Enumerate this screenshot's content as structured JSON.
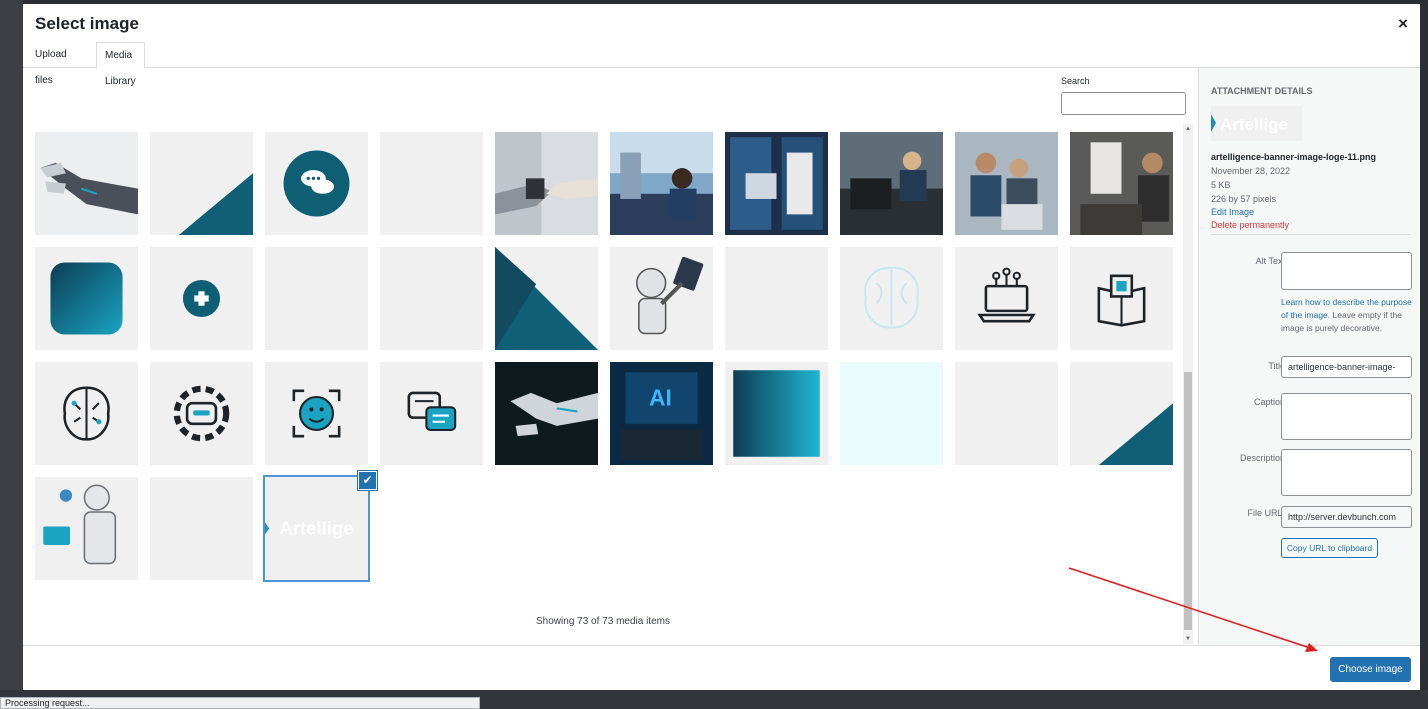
{
  "modal": {
    "title": "Select image",
    "close_label": "×",
    "tabs": [
      {
        "label": "Upload files",
        "active": false
      },
      {
        "label": "Media Library",
        "active": true
      }
    ]
  },
  "search": {
    "label": "Search",
    "value": ""
  },
  "media_grid": {
    "items": [
      {
        "kind": "robot-hand"
      },
      {
        "kind": "triangle"
      },
      {
        "kind": "chat-bubble-icon"
      },
      {
        "kind": "blank"
      },
      {
        "kind": "robot-handshake-photo"
      },
      {
        "kind": "lab-photo"
      },
      {
        "kind": "server-rack-photo"
      },
      {
        "kind": "engineer-photo"
      },
      {
        "kind": "team-laptop-photo"
      },
      {
        "kind": "robot-hand-photo"
      },
      {
        "kind": "rounded-square"
      },
      {
        "kind": "plus-circle"
      },
      {
        "kind": "blank"
      },
      {
        "kind": "blank"
      },
      {
        "kind": "triangle-left"
      },
      {
        "kind": "humanoid-robot"
      },
      {
        "kind": "blank"
      },
      {
        "kind": "brain-outline"
      },
      {
        "kind": "laptop-circuit-icon"
      },
      {
        "kind": "book-chip-icon"
      },
      {
        "kind": "brain-circuit-icon"
      },
      {
        "kind": "gear-robot-icon"
      },
      {
        "kind": "face-scan-icon"
      },
      {
        "kind": "chatbot-icon"
      },
      {
        "kind": "robot-hand-dark"
      },
      {
        "kind": "ai-laptop-photo"
      },
      {
        "kind": "gradient-square"
      },
      {
        "kind": "light-cyan"
      },
      {
        "kind": "blank"
      },
      {
        "kind": "triangle"
      },
      {
        "kind": "white-robot"
      },
      {
        "kind": "blank"
      },
      {
        "kind": "artelligence-logo",
        "selected": true
      }
    ],
    "selected_logo_text": "Artellige",
    "showing_text": "Showing 73 of 73 media items"
  },
  "attachment": {
    "heading": "Attachment Details",
    "thumb_text": "Artellige",
    "filename": "artelligence-banner-image-loge-11.png",
    "date": "November 28, 2022",
    "size": "5 KB",
    "dimensions": "226 by 57 pixels",
    "edit_label": "Edit Image",
    "delete_label": "Delete permanently",
    "alt_label": "Alt Text",
    "alt_value": "",
    "alt_help": "Learn how to describe the purpose of the image.",
    "alt_help_tail": " Leave empty if the image is purely decorative.",
    "title_label": "Title",
    "title_value": "artelligence-banner-image-",
    "caption_label": "Caption",
    "caption_value": "",
    "description_label": "Description",
    "description_value": "",
    "url_label": "File URL:",
    "url_value": "http://server.devbunch.com",
    "copy_label": "Copy URL to clipboard"
  },
  "footer": {
    "choose_label": "Choose image"
  },
  "status_bar": {
    "text": "Processing request..."
  },
  "colors": {
    "primary": "#2271b1",
    "teal": "#0e5e74",
    "danger": "#d63638",
    "annotation_arrow": "#e02020"
  }
}
